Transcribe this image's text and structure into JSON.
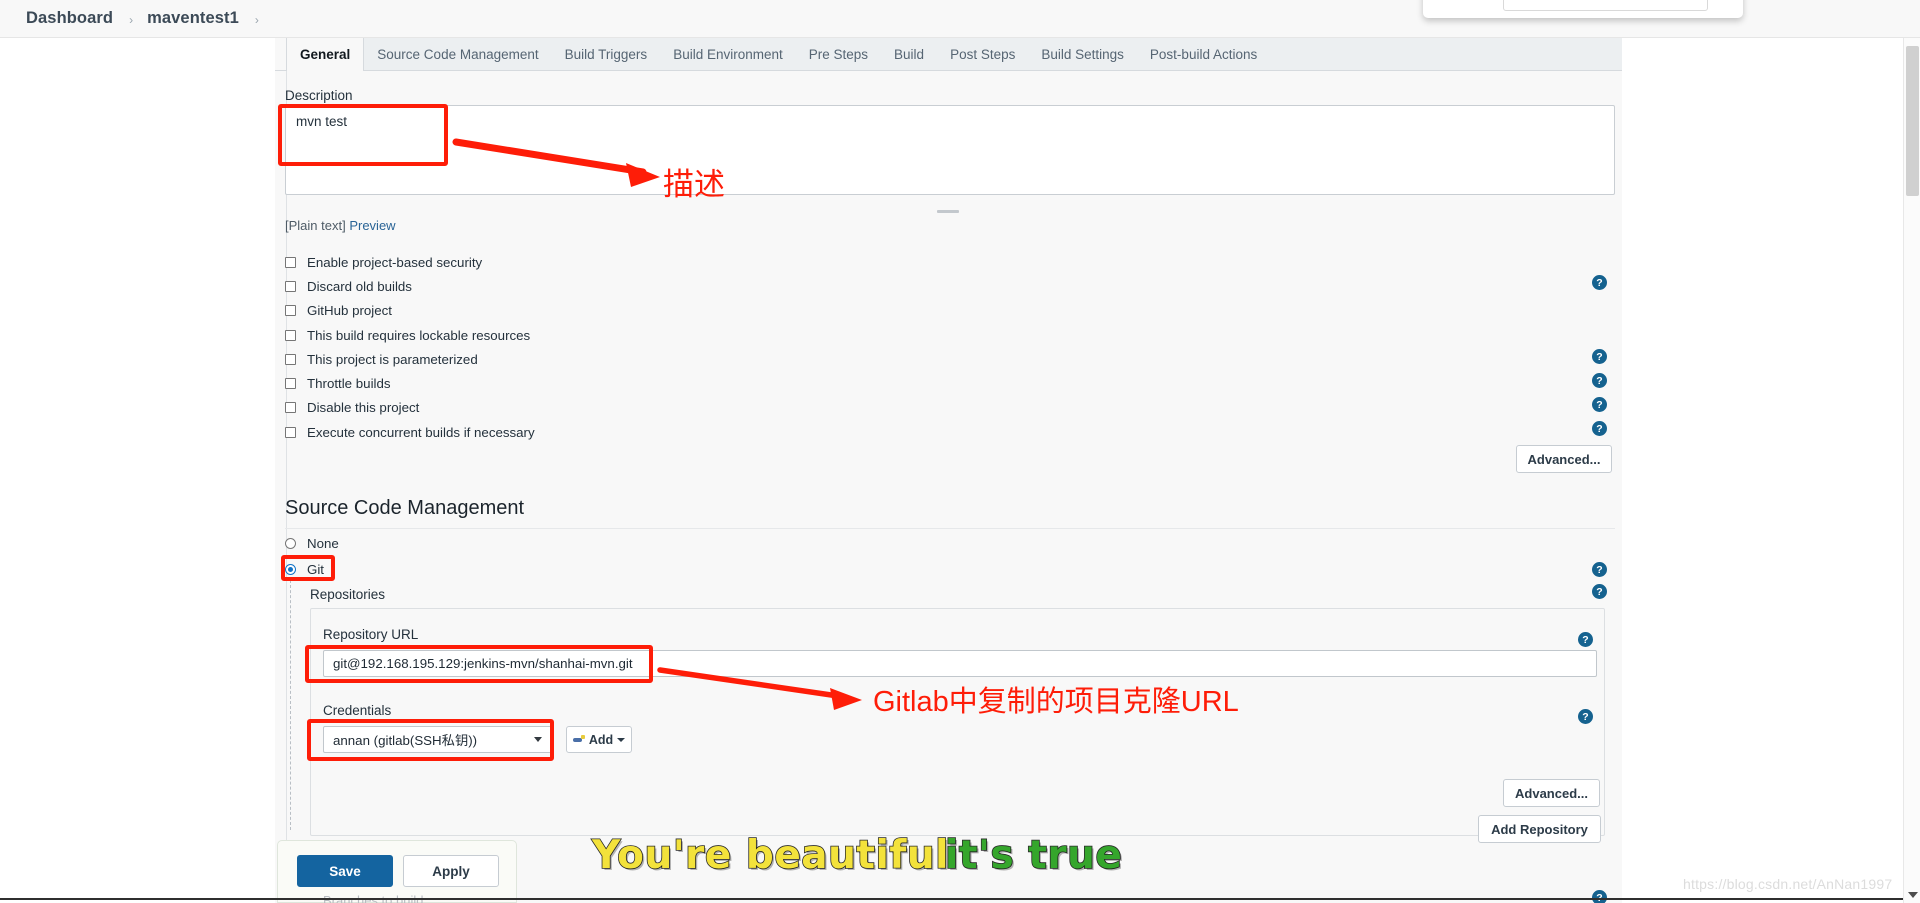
{
  "breadcrumb": {
    "items": [
      "Dashboard",
      "maventest1"
    ],
    "separator": "›"
  },
  "tabs": [
    {
      "label": "General",
      "active": true
    },
    {
      "label": "Source Code Management",
      "active": false
    },
    {
      "label": "Build Triggers",
      "active": false
    },
    {
      "label": "Build Environment",
      "active": false
    },
    {
      "label": "Pre Steps",
      "active": false
    },
    {
      "label": "Build",
      "active": false
    },
    {
      "label": "Post Steps",
      "active": false
    },
    {
      "label": "Build Settings",
      "active": false
    },
    {
      "label": "Post-build Actions",
      "active": false
    }
  ],
  "general": {
    "description_label": "Description",
    "description_value": "mvn test",
    "description_placeholder": "",
    "plain_text_label": "[Plain text]",
    "preview_link": "Preview",
    "checkboxes": [
      {
        "label": "Enable project-based security",
        "checked": false
      },
      {
        "label": "Discard old builds",
        "checked": false
      },
      {
        "label": "GitHub project",
        "checked": false
      },
      {
        "label": "This build requires lockable resources",
        "checked": false
      },
      {
        "label": "This project is parameterized",
        "checked": false
      },
      {
        "label": "Throttle builds",
        "checked": false
      },
      {
        "label": "Disable this project",
        "checked": false
      },
      {
        "label": "Execute concurrent builds if necessary",
        "checked": false
      }
    ],
    "advanced_button": "Advanced..."
  },
  "scm": {
    "heading": "Source Code Management",
    "options": [
      {
        "label": "None",
        "selected": false
      },
      {
        "label": "Git",
        "selected": true
      }
    ],
    "repositories_label": "Repositories",
    "repository_url_label": "Repository URL",
    "repository_url_value": "git@192.168.195.129:jenkins-mvn/shanhai-mvn.git",
    "credentials_label": "Credentials",
    "credentials_value": "annan (gitlab(SSH私钥))",
    "add_button": "Add",
    "advanced_button": "Advanced...",
    "add_repository_button": "Add Repository",
    "branches_ghost": "Branches to build"
  },
  "footer": {
    "save_label": "Save",
    "apply_label": "Apply"
  },
  "help_icon_glyph": "?",
  "annotations": {
    "description_note": "描述",
    "url_note": "Gitlab中复制的项目克隆URL",
    "accent_color": "#fe1d08"
  },
  "watermarks": {
    "phrase_yellow": "You're beautiful",
    "phrase_green": "it's true",
    "blog_url": "https://blog.csdn.net/AnNan1997",
    "yellow_color": "#f3e23b",
    "green_color": "#35a62c"
  }
}
